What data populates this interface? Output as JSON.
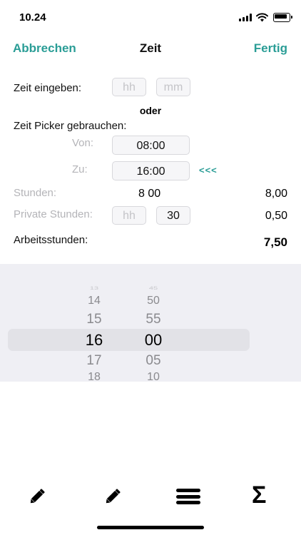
{
  "status": {
    "time": "10.24"
  },
  "nav": {
    "cancel": "Abbrechen",
    "title": "Zeit",
    "done": "Fertig"
  },
  "form": {
    "zeit_eingeben": "Zeit eingeben:",
    "hh_placeholder": "hh",
    "mm_placeholder": "mm",
    "oder": "oder",
    "picker_label": "Zeit Picker gebrauchen:",
    "von_label": "Von:",
    "von_value": "08:00",
    "zu_label": "Zu:",
    "zu_value": "16:00",
    "arrow": "<<<",
    "stunden_label": "Stunden:",
    "stunden_value": "8 00",
    "stunden_decimal": "8,00",
    "private_label": "Private Stunden:",
    "private_hh": "hh",
    "private_mm": "30",
    "private_decimal": "0,50",
    "arbeit_label": "Arbeitsstunden:",
    "arbeit_value": "7,50"
  },
  "picker": {
    "hours": [
      "13",
      "14",
      "15",
      "16",
      "17",
      "18"
    ],
    "minutes": [
      "45",
      "50",
      "55",
      "00",
      "05",
      "10"
    ]
  },
  "tabbar": {
    "icons": [
      "pencil-icon",
      "pencil-icon",
      "menu-icon",
      "sigma-icon"
    ],
    "sigma": "Σ"
  }
}
